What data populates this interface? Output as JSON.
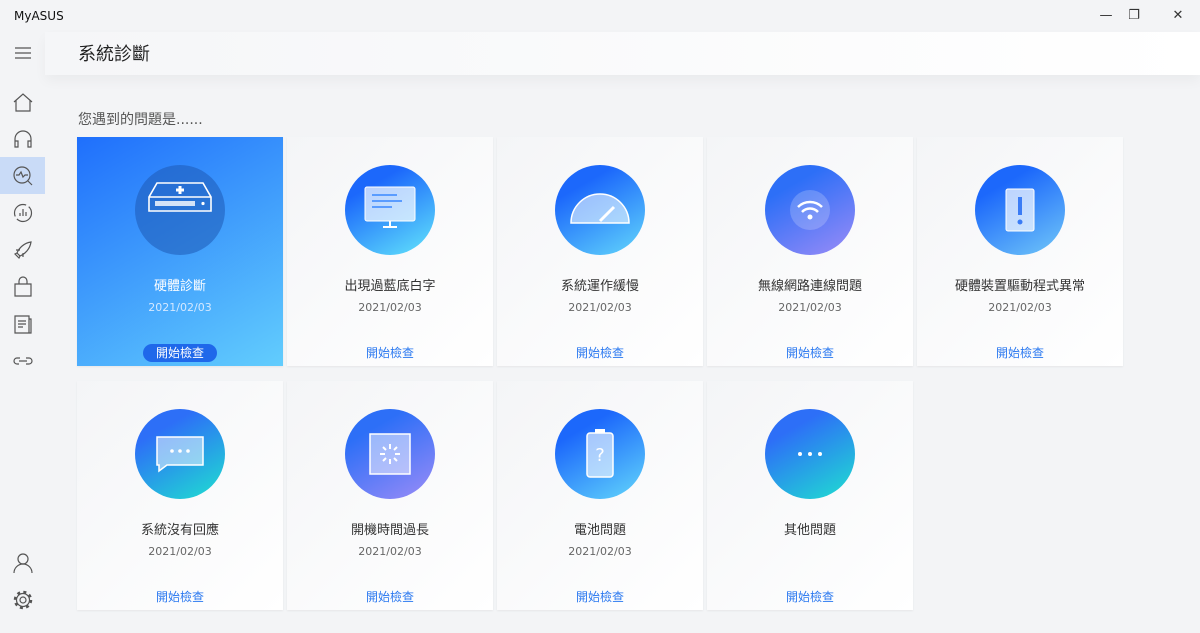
{
  "app": {
    "title": "MyASUS"
  },
  "header": {
    "title": "系統診斷"
  },
  "prompt": "您遇到的問題是......",
  "cards": [
    {
      "title": "硬體診斷",
      "date": "2021/02/03",
      "button": "開始檢查",
      "icon": "hard-drive-icon"
    },
    {
      "title": "出現過藍底白字",
      "date": "2021/02/03",
      "button": "開始檢查",
      "icon": "monitor-icon"
    },
    {
      "title": "系統運作緩慢",
      "date": "2021/02/03",
      "button": "開始檢查",
      "icon": "speedometer-icon"
    },
    {
      "title": "無線網路連線問題",
      "date": "2021/02/03",
      "button": "開始檢查",
      "icon": "wifi-icon"
    },
    {
      "title": "硬體裝置驅動程式異常",
      "date": "2021/02/03",
      "button": "開始檢查",
      "icon": "chip-warning-icon"
    },
    {
      "title": "系統沒有回應",
      "date": "2021/02/03",
      "button": "開始檢查",
      "icon": "chat-ellipsis-icon"
    },
    {
      "title": "開機時間過長",
      "date": "2021/02/03",
      "button": "開始檢查",
      "icon": "loading-screen-icon"
    },
    {
      "title": "電池問題",
      "date": "2021/02/03",
      "button": "開始檢查",
      "icon": "battery-question-icon"
    },
    {
      "title": "其他問題",
      "date": "",
      "button": "開始檢查",
      "icon": "more-icon"
    }
  ],
  "colors": {
    "accent": "#2a78f0",
    "active_start": "#1f6ffc",
    "active_end": "#62cdfd"
  }
}
